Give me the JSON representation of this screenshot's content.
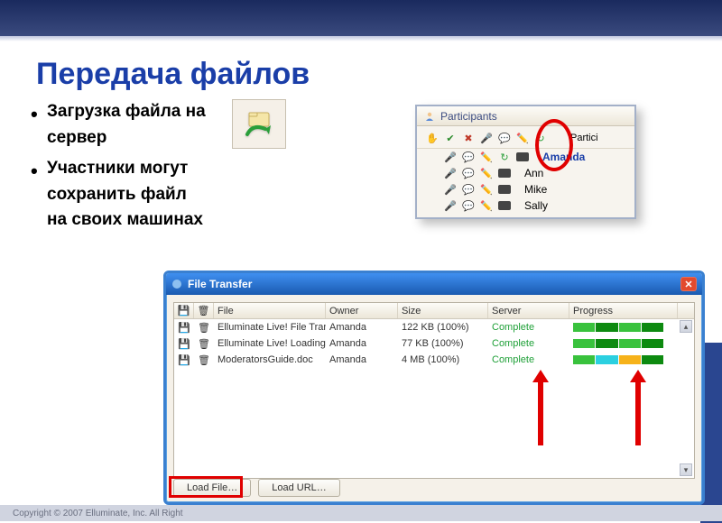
{
  "slide": {
    "title": "Передача файлов",
    "bullets": [
      "Загрузка файла на сервер",
      "Участники могут сохранить файл на своих машинах"
    ]
  },
  "participants_panel": {
    "header": "Participants",
    "header_row_label": "Partici",
    "rows": [
      {
        "name": "Amanda",
        "highlighted": true
      },
      {
        "name": "Ann",
        "highlighted": false
      },
      {
        "name": "Mike",
        "highlighted": false
      },
      {
        "name": "Sally",
        "highlighted": false
      }
    ]
  },
  "file_transfer_window": {
    "title": "File Transfer",
    "columns": {
      "file": "File",
      "owner": "Owner",
      "size": "Size",
      "server": "Server",
      "progress": "Progress"
    },
    "rows": [
      {
        "file": "Elluminate Live! File Transfer Quick Re…",
        "owner": "Amanda",
        "size": "122 KB (100%)",
        "server": "Complete"
      },
      {
        "file": "Elluminate Live! Loading Presentations…",
        "owner": "Amanda",
        "size": "77 KB (100%)",
        "server": "Complete"
      },
      {
        "file": "ModeratorsGuide.doc",
        "owner": "Amanda",
        "size": "4 MB (100%)",
        "server": "Complete"
      }
    ],
    "buttons": {
      "load_file": "Load File…",
      "load_url": "Load URL…"
    }
  },
  "footer": {
    "text": "Copyright © 2007 Elluminate, Inc. All Right"
  }
}
